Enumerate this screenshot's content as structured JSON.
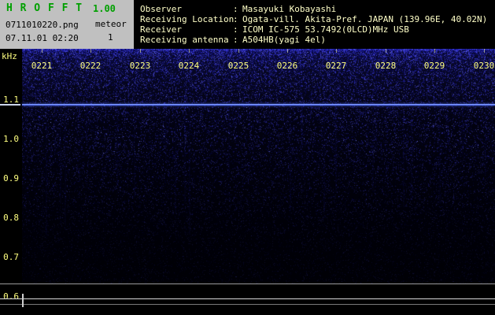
{
  "app": {
    "title": "H R O F F T",
    "version": "1.00",
    "filename": "0711010220.png",
    "mode_label": "meteor",
    "timestamp": "07.11.01 02:20",
    "count": "1"
  },
  "header": {
    "separator": ":",
    "rows": [
      {
        "label": "Observer",
        "value": "Masayuki Kobayashi"
      },
      {
        "label": "Receiving Location",
        "value": "Ogata-vill. Akita-Pref. JAPAN (139.96E, 40.02N)"
      },
      {
        "label": "Receiver",
        "value": "ICOM IC-575 53.7492(0LCD)MHz USB"
      },
      {
        "label": "Receiving antenna",
        "value": "A504HB(yagi 4el)"
      }
    ]
  },
  "chart_data": {
    "type": "heatmap",
    "title": "HROFFT radio meteor echo spectrogram",
    "ylabel": "kHz",
    "y_ticks": [
      "1.1",
      "1.0",
      "0.9",
      "0.8",
      "0.7",
      "0.6"
    ],
    "y_range": [
      0.55,
      1.15
    ],
    "x_ticks": [
      "0221",
      "0222",
      "0223",
      "0224",
      "0225",
      "0226",
      "0227",
      "0228",
      "0229",
      "0230"
    ],
    "carrier_line_khz": 1.09,
    "grid": false,
    "legend": "none",
    "noise_description": "dark blue random background noise, densest above 1.0 kHz, fading toward lower frequencies; continuous bright blue carrier line near 1.09 kHz; empty signal-level strip below 0.65 kHz with two horizontal baseline lines"
  },
  "colors": {
    "panel_gray": "#c0c0c0",
    "title_green": "#00a000",
    "header_text": "#ffffc8",
    "axis_text": "#ffff80",
    "carrier_blue": "#4a66f0",
    "background": "#000000"
  }
}
